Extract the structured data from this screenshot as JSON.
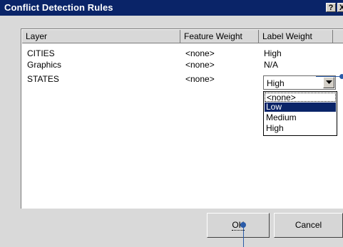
{
  "window": {
    "title": "Conflict Detection Rules",
    "help_label": "?",
    "close_label": "X"
  },
  "table": {
    "columns": [
      "Layer",
      "Feature Weight",
      "Label Weight",
      ""
    ],
    "rows": [
      {
        "layer": "CITIES",
        "feature_weight": "<none>",
        "label_weight": "High"
      },
      {
        "layer": "Graphics",
        "feature_weight": "<none>",
        "label_weight": "N/A"
      },
      {
        "layer": "STATES",
        "feature_weight": "<none>",
        "label_weight": "High"
      }
    ]
  },
  "label_weight_combo": {
    "value": "High",
    "options": [
      "<none>",
      "Low",
      "Medium",
      "High"
    ],
    "highlighted": "Low"
  },
  "buttons": {
    "ok": "OK",
    "cancel": "Cancel"
  },
  "colors": {
    "titlebar": "#0a2468",
    "selection": "#0a2468",
    "callout": "#2a5ba8",
    "dialog_bg": "#d9d9d9"
  }
}
